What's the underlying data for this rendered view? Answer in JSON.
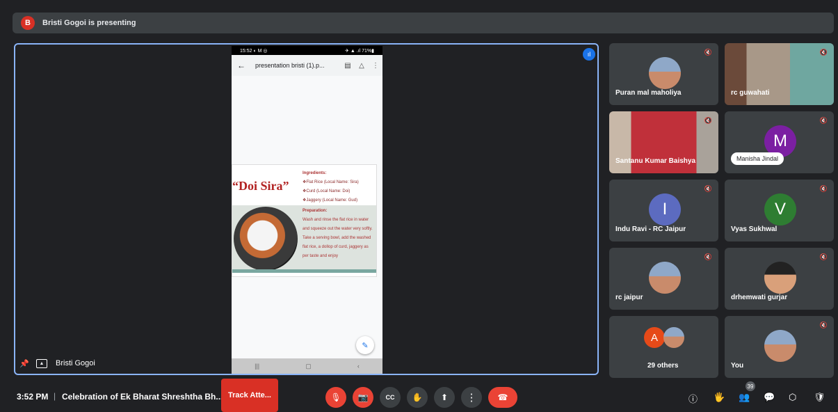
{
  "banner": {
    "avatar_letter": "B",
    "text": "Bristi Gogoi is presenting"
  },
  "presentation": {
    "phone_status_left": "15:52 ◐ M ◎",
    "phone_status_right": "✈ ▲ .ıl 71%▮",
    "file_title": "presentation bristi (1).p...",
    "slide_title": "“Doi Sira”",
    "ingredients_heading": "Ingredients:",
    "ingredients": [
      "❖Flat Rice (Local Name: Sira)",
      "❖Curd (Local Name: Doi)",
      "❖Jaggery (Local Name: Gud)"
    ],
    "preparation_heading": "Preparation:",
    "preparation_text": "Wash and rinse the flat rice in water and squeeze out the water very softly. Take a serving bowl, add the washed flat rice, a dollop of curd, jaggery as per taste and enjoy"
  },
  "stage": {
    "presenter_name": "Bristi Gogoi"
  },
  "participants": [
    {
      "name": "Puran mal maholiya",
      "kind": "photo"
    },
    {
      "name": "rc guwahati",
      "kind": "video"
    },
    {
      "name": "Santanu Kumar Baishya",
      "kind": "video"
    },
    {
      "name": "Manisha Jindal",
      "kind": "letter",
      "letter": "M",
      "color": "#7b1fa2"
    },
    {
      "name": "Indu Ravi - RC Jaipur",
      "kind": "letter",
      "letter": "I",
      "color": "#5c6bc0"
    },
    {
      "name": "Vyas Sukhwal",
      "kind": "letter",
      "letter": "V",
      "color": "#2e7d32"
    },
    {
      "name": "rc jaipur",
      "kind": "photo"
    },
    {
      "name": "drhemwati gurjar",
      "kind": "photo"
    },
    {
      "name": "29 others",
      "kind": "others",
      "letter": "A",
      "color": "#e64a19"
    },
    {
      "name": "You",
      "kind": "photo"
    }
  ],
  "bottom": {
    "time": "3:52 PM",
    "separator": "|",
    "meeting_title": "Celebration of Ek Bharat Shreshtha Bh...",
    "track_button": "Track Atte...",
    "people_count": "39"
  },
  "icons": {
    "mic_off": "🎙",
    "cam_off": "📷",
    "cc": "CC",
    "hand": "✋",
    "present": "⬆",
    "more": "⋮",
    "end": "☎",
    "info": "ⓘ",
    "people": "👥",
    "chat": "💬",
    "activities": "⬡",
    "host": "🛡",
    "mute": "🔇",
    "pin": "📌",
    "back": "←",
    "edit": "✎"
  },
  "colors": {
    "accent_blue": "#8ab4f8",
    "danger_red": "#ea4335",
    "tile_bg": "#3c4043"
  }
}
